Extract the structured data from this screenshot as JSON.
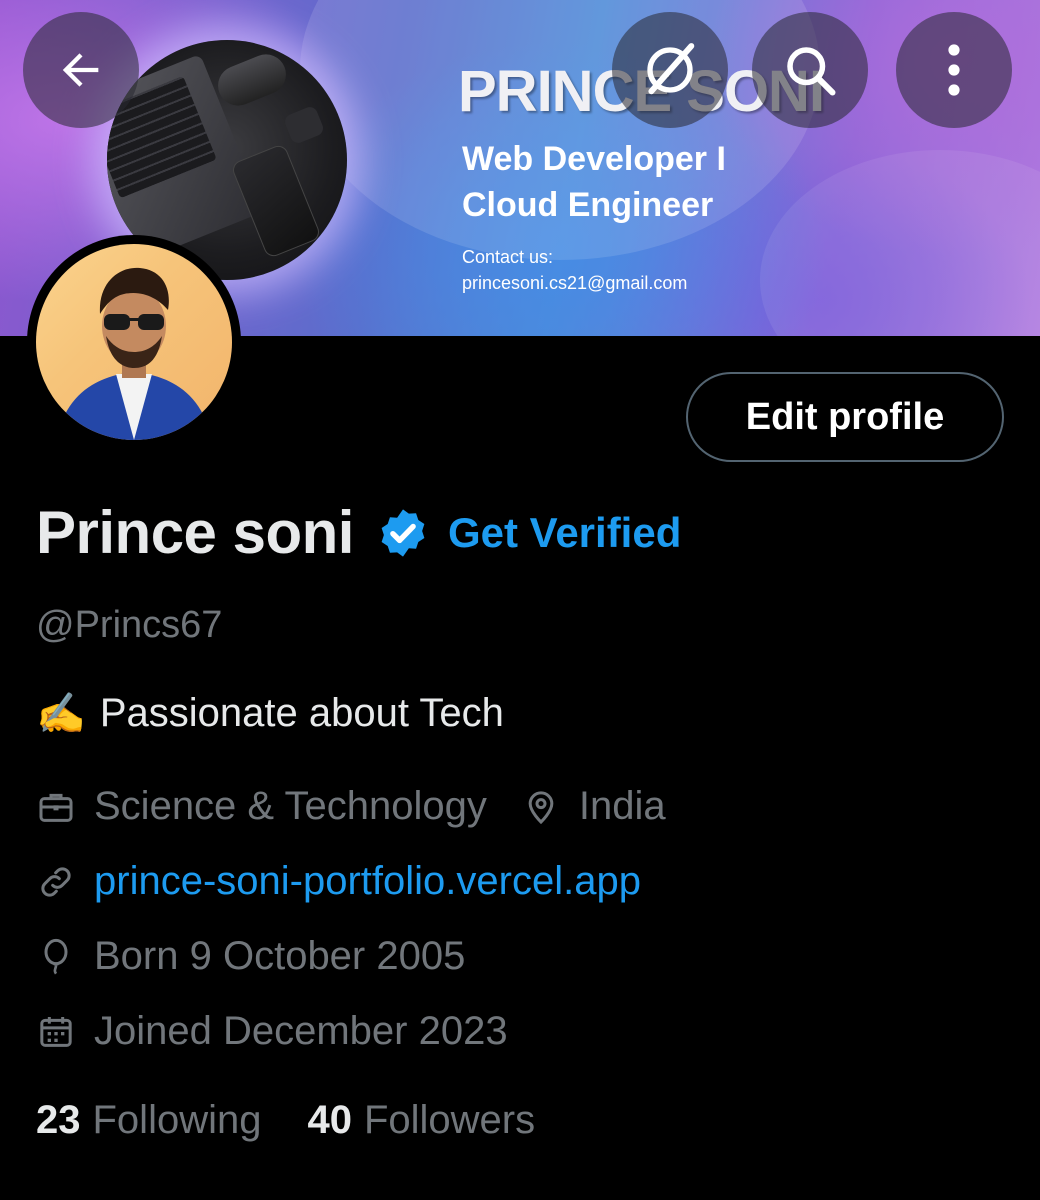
{
  "banner": {
    "title": "PRINCE SONI",
    "role_line1": "Web Developer I",
    "role_line2": "Cloud Engineer",
    "contact_label": "Contact us:",
    "contact_email": "princesoni.cs21@gmail.com"
  },
  "top_bar": {
    "back_icon": "arrow-left-icon",
    "grok_icon": "grok-icon",
    "search_icon": "search-icon",
    "more_icon": "more-vertical-icon"
  },
  "profile": {
    "edit_label": "Edit profile",
    "name": "Prince soni",
    "get_verified": "Get Verified",
    "handle": "@Princs67",
    "bio_emoji": "✍️",
    "bio_text": "Passionate about Tech",
    "category": "Science & Technology",
    "location": "India",
    "website": "prince-soni-portfolio.vercel.app",
    "birthday": "Born 9 October 2005",
    "joined": "Joined December 2023",
    "following_count": "23",
    "following_label": "Following",
    "followers_count": "40",
    "followers_label": "Followers"
  },
  "colors": {
    "accent": "#1d9bf0",
    "secondary_text": "#71767b",
    "primary_text": "#e7e9ea",
    "background": "#000000"
  }
}
